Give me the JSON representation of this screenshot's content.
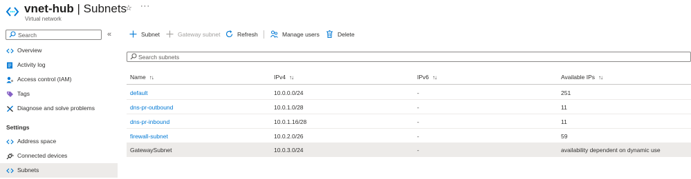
{
  "header": {
    "resource_name": "vnet-hub",
    "separator": " | ",
    "page_name": "Subnets",
    "subtitle": "Virtual network",
    "star_glyph": "☆",
    "more_glyph": "···"
  },
  "sidebar": {
    "search_placeholder": "Search",
    "collapse_glyph": "«",
    "items": [
      {
        "label": "Overview",
        "icon": "vnet-icon"
      },
      {
        "label": "Activity log",
        "icon": "activity-log-icon"
      },
      {
        "label": "Access control (IAM)",
        "icon": "iam-icon"
      },
      {
        "label": "Tags",
        "icon": "tag-icon"
      },
      {
        "label": "Diagnose and solve problems",
        "icon": "wrench-icon"
      }
    ],
    "section_settings": "Settings",
    "settings_items": [
      {
        "label": "Address space",
        "icon": "vnet-icon"
      },
      {
        "label": "Connected devices",
        "icon": "plug-icon"
      },
      {
        "label": "Subnets",
        "icon": "vnet-icon",
        "active": true
      }
    ]
  },
  "toolbar": {
    "subnet": "Subnet",
    "gateway_subnet": "Gateway subnet",
    "refresh": "Refresh",
    "manage_users": "Manage users",
    "delete": "Delete"
  },
  "grid_search": {
    "placeholder": "Search subnets"
  },
  "table": {
    "columns": [
      "Name",
      "IPv4",
      "IPv6",
      "Available IPs"
    ],
    "sort_glyph": "↑↓",
    "rows": [
      {
        "name": "default",
        "ipv4": "10.0.0.0/24",
        "ipv6": "-",
        "available": "251"
      },
      {
        "name": "dns-pr-outbound",
        "ipv4": "10.0.1.0/28",
        "ipv6": "-",
        "available": "11"
      },
      {
        "name": "dns-pr-inbound",
        "ipv4": "10.0.1.16/28",
        "ipv6": "-",
        "available": "11"
      },
      {
        "name": "firewall-subnet",
        "ipv4": "10.0.2.0/26",
        "ipv6": "-",
        "available": "59"
      },
      {
        "name": "GatewaySubnet",
        "ipv4": "10.0.3.0/24",
        "ipv6": "-",
        "available": "availability dependent on dynamic use"
      }
    ]
  },
  "colors": {
    "accent": "#0078d4",
    "selected_row": "#edebe9",
    "text": "#323130"
  }
}
